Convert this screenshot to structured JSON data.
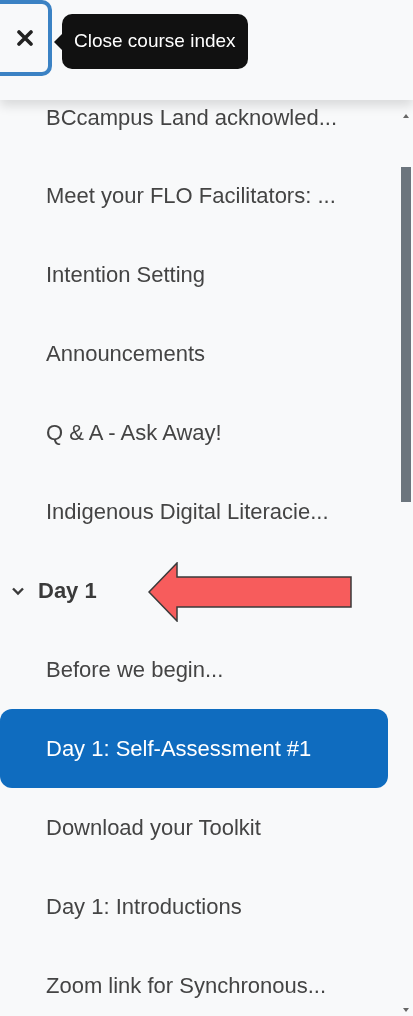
{
  "close_button": {
    "tooltip": "Close course index"
  },
  "items": [
    {
      "kind": "activity",
      "label": "BCcampus Land acknowled...",
      "selected": false
    },
    {
      "kind": "activity",
      "label": "Meet your FLO Facilitators: ...",
      "selected": false
    },
    {
      "kind": "activity",
      "label": "Intention Setting",
      "selected": false
    },
    {
      "kind": "activity",
      "label": "Announcements",
      "selected": false
    },
    {
      "kind": "activity",
      "label": "Q & A - Ask Away!",
      "selected": false
    },
    {
      "kind": "activity",
      "label": "Indigenous Digital Literacie...",
      "selected": false
    },
    {
      "kind": "section",
      "label": "Day 1",
      "expanded": true,
      "selected": false
    },
    {
      "kind": "activity",
      "label": "Before we begin...",
      "selected": false
    },
    {
      "kind": "activity",
      "label": "Day 1: Self-Assessment #1",
      "selected": true
    },
    {
      "kind": "activity",
      "label": "Download your Toolkit",
      "selected": false
    },
    {
      "kind": "activity",
      "label": "Day 1: Introductions",
      "selected": false
    },
    {
      "kind": "activity",
      "label": "Zoom link for Synchronous...",
      "selected": false
    }
  ]
}
